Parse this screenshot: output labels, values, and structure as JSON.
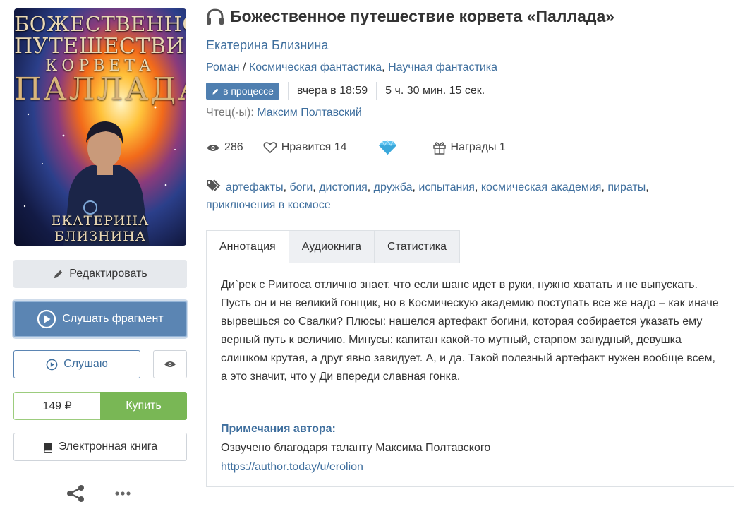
{
  "cover": {
    "title_line1": "БОЖЕСТВЕННОЕ",
    "title_line2": "ПУТЕШЕСТВИЕ",
    "title_line3": "КОРВЕТА",
    "title_line4": "ПАЛЛАДА",
    "author": "ЕКАТЕРИНА БЛИЗНИНА"
  },
  "sidebar": {
    "edit_label": "Редактировать",
    "listen_fragment_label": "Слушать фрагмент",
    "listening_label": "Слушаю",
    "price": "149 ₽",
    "buy_label": "Купить",
    "ebook_label": "Электронная книга"
  },
  "book": {
    "title": "Божественное путешествие корвета «Паллада»",
    "author": "Екатерина Близнина",
    "genre_primary": "Роман",
    "genre_sep": " / ",
    "genres": [
      "Космическая фантастика",
      "Научная фантастика"
    ],
    "status_badge": "в процессе",
    "updated": "вчера в 18:59",
    "duration": "5 ч. 30 мин. 15 сек.",
    "reader_label": "Чтец(-ы):",
    "reader_name": "Максим Полтавский"
  },
  "stats": {
    "views": "286",
    "likes_label": "Нравится 14",
    "awards_label": "Награды 1"
  },
  "tags": [
    "артефакты",
    "боги",
    "дистопия",
    "дружба",
    "испытания",
    "космическая академия",
    "пираты",
    "приключения в космосе"
  ],
  "tabs": [
    "Аннотация",
    "Аудиокнига",
    "Статистика"
  ],
  "annotation": "Ди`рек с Риитоса отлично знает, что если шанс идет в руки, нужно хватать и не выпускать. Пусть он и не великий гонщик, но в Космическую академию поступать все же надо – как иначе вырвешься со Свалки? Плюсы: нашелся артефакт богини, которая собирается указать ему верный путь к величию. Минусы: капитан какой-то мутный, старпом занудный, девушка слишком крутая, а друг явно завидует. А, и да. Такой полезный артефакт нужен вообще всем, а это значит, что у Ди впереди славная гонка.",
  "notes": {
    "title": "Примечания автора:",
    "text": "Озвучено благодаря таланту Максима Полтавского",
    "link": "https://author.today/u/erolion"
  },
  "colors": {
    "accent": "#5b85b3",
    "link": "#3f6f9e",
    "buy": "#79b755",
    "badge": "#4f7fb0"
  }
}
